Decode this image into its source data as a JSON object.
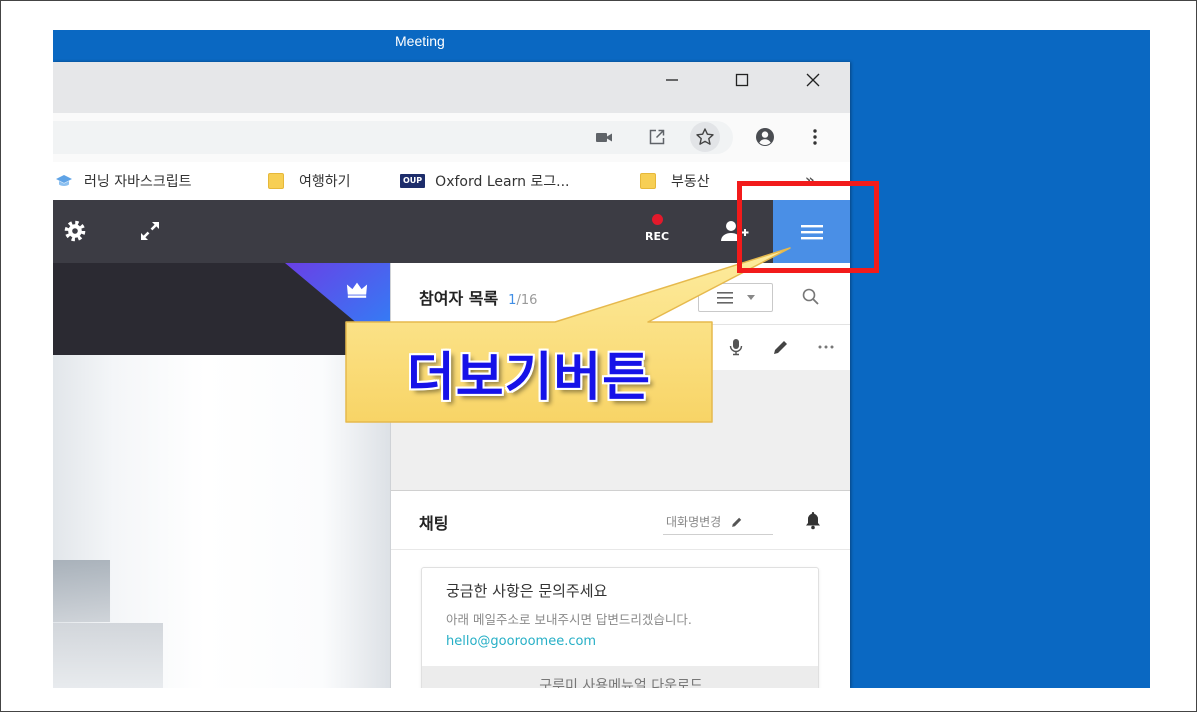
{
  "desktop": {
    "title": "Meeting"
  },
  "browser": {
    "window_controls": [
      "minimize-icon",
      "maximize-icon",
      "close-icon"
    ],
    "address_icons": [
      "video-camera-icon",
      "open-in-new-icon",
      "star-icon",
      "account-circle-icon",
      "more-vert-icon"
    ],
    "bookmarks": [
      {
        "label": "러닝 자바스크립트",
        "icon": "graduation-cap-icon"
      },
      {
        "label": "여행하기",
        "icon": "folder-icon"
      },
      {
        "label": "Oxford Learn 로그...",
        "icon": "oup-icon",
        "badge": "OUP"
      },
      {
        "label": "부동산",
        "icon": "folder-icon"
      }
    ],
    "bookmarks_more": "»"
  },
  "meeting_toolbar": {
    "icons": [
      "gear-icon",
      "fullscreen-icon",
      "rec-dot-icon",
      "add-user-icon",
      "menu-icon"
    ],
    "rec_label": "REC"
  },
  "participants": {
    "title": "참여자 목록",
    "count": "1",
    "total": "/16"
  },
  "chat": {
    "title": "채팅",
    "rename_label": "대화명변경",
    "notice": {
      "heading": "궁금한 사항은 문의주세요",
      "body": "아래 메일주소로 보내주시면 답변드리겠습니다.",
      "email": "hello@gooroomee.com",
      "manual_button": "구루미 사용메뉴얼 다운로드"
    }
  },
  "callout": {
    "text": "더보기버튼"
  },
  "colors": {
    "desktop_blue": "#0a68c2",
    "toolbar_dark": "#3c3c44",
    "menu_button_blue": "#4a8fe6",
    "rec_red": "#e3192b",
    "count_blue": "#3f8ee6",
    "link_teal": "#26afc6",
    "callout_text": "#1612e8",
    "highlight_red": "#f21b1b"
  }
}
